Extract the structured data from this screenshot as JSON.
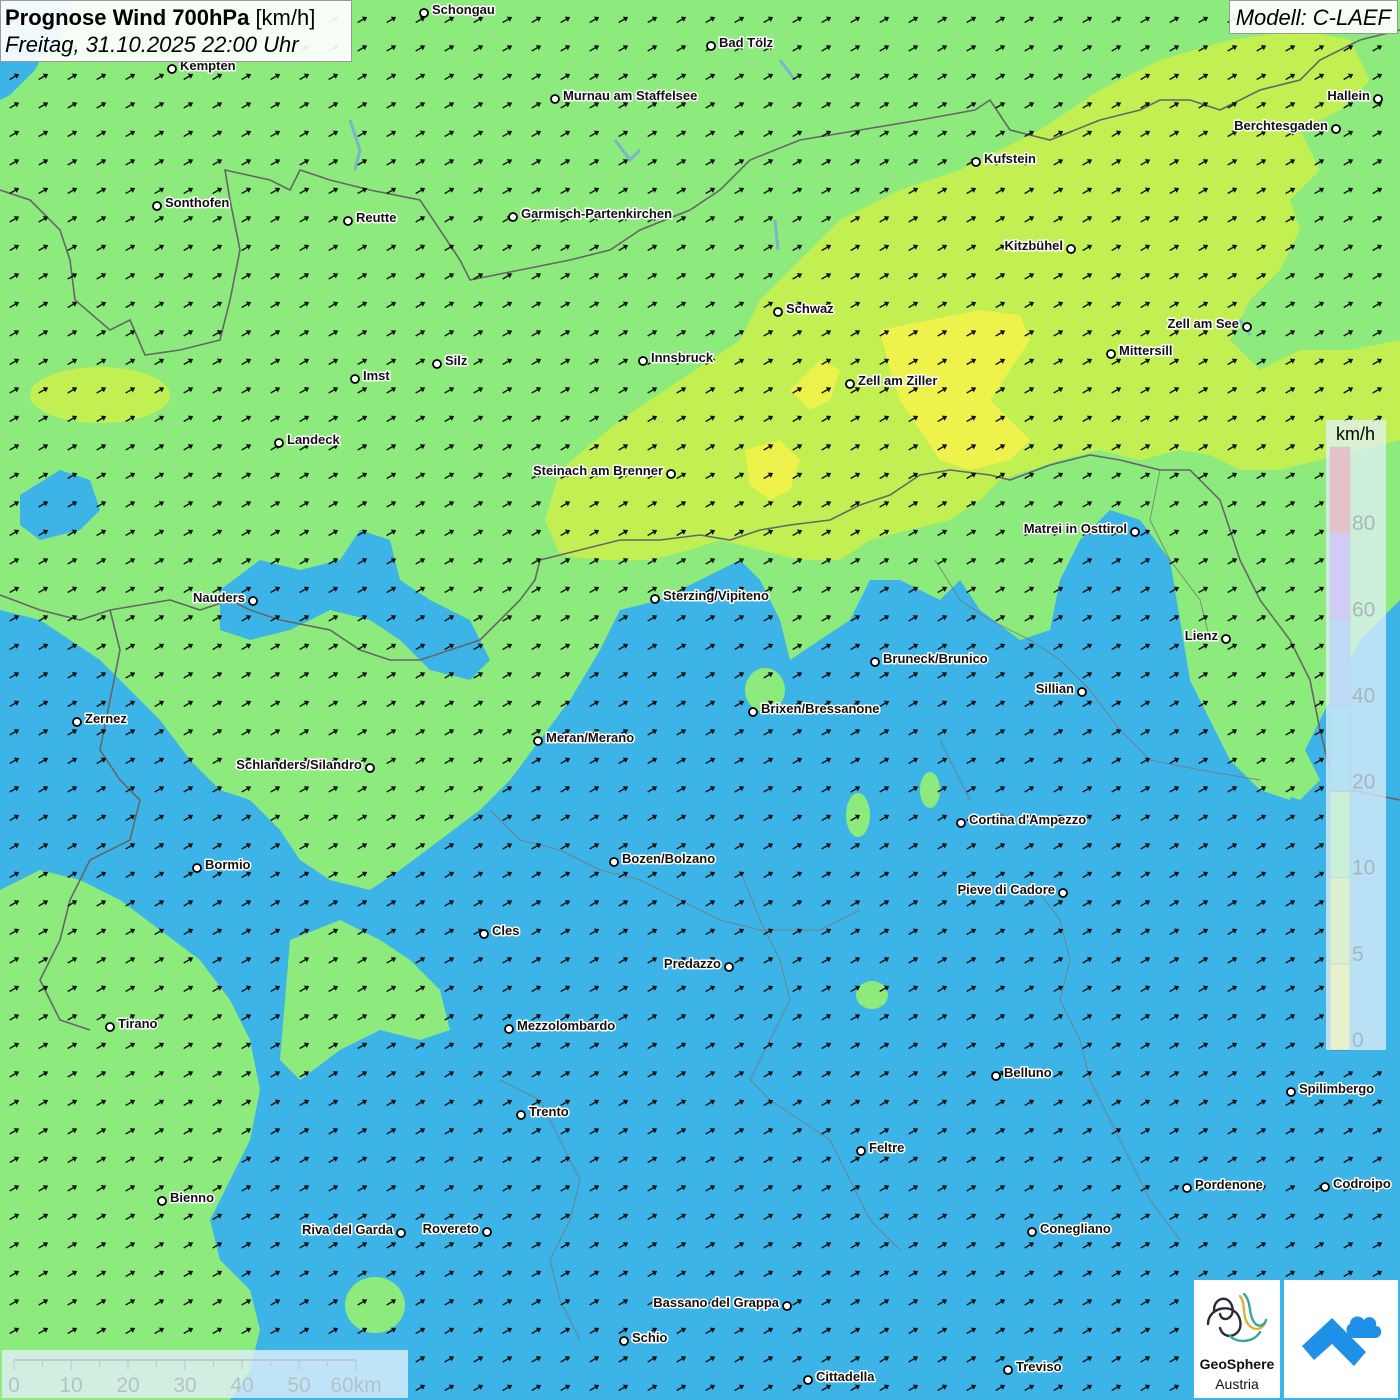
{
  "header": {
    "title_bold": "Prognose Wind 700hPa",
    "title_unit": "[km/h]",
    "datetime": "Freitag, 31.10.2025 22:00 Uhr",
    "model": "Modell: C-LAEF"
  },
  "legend": {
    "unit": "km/h",
    "bins": [
      {
        "color": "#f7f24a",
        "from": 0
      },
      {
        "color": "#c2f052",
        "from": 5
      },
      {
        "color": "#8ceb7c",
        "from": 10
      },
      {
        "color": "#2cbbe8",
        "from": 20
      },
      {
        "color": "#5a96ec",
        "from": 40
      },
      {
        "color": "#9a5ff0",
        "from": 60
      },
      {
        "color": "#ef3838",
        "from": 80
      }
    ],
    "tick_labels": [
      "0",
      "5",
      "10",
      "20",
      "40",
      "60",
      "80"
    ]
  },
  "scalebar": {
    "labels": [
      "0",
      "10",
      "20",
      "30",
      "40",
      "50",
      "60km"
    ]
  },
  "logos": {
    "geosphere_line1": "GeoSphere",
    "geosphere_line2": "Austria"
  },
  "colors": {
    "zone_0_5": "#f7f24a",
    "zone_5_10": "#c2f052",
    "zone_10_20": "#8ceb7c",
    "zone_20_40": "#2cbbe8",
    "arrow": "#111111",
    "border": "#666666"
  },
  "places": [
    {
      "name": "Schongau",
      "side": "right"
    },
    {
      "name": "Bad Tölz",
      "side": "right"
    },
    {
      "name": "Kempten",
      "side": "right"
    },
    {
      "name": "Murnau am Staffelsee",
      "side": "right"
    },
    {
      "name": "Hallein",
      "side": "left"
    },
    {
      "name": "Berchtesgaden",
      "side": "left"
    },
    {
      "name": "Kufstein",
      "side": "right"
    },
    {
      "name": "Sonthofen",
      "side": "right"
    },
    {
      "name": "Reutte",
      "side": "right"
    },
    {
      "name": "Garmisch-Partenkirchen",
      "side": "right"
    },
    {
      "name": "Kitzbühel",
      "side": "left"
    },
    {
      "name": "Schwaz",
      "side": "right"
    },
    {
      "name": "Zell am See",
      "side": "left"
    },
    {
      "name": "Mittersill",
      "side": "right"
    },
    {
      "name": "Innsbruck",
      "side": "right"
    },
    {
      "name": "Silz",
      "side": "right"
    },
    {
      "name": "Imst",
      "side": "right"
    },
    {
      "name": "Zell am Ziller",
      "side": "right"
    },
    {
      "name": "Landeck",
      "side": "right"
    },
    {
      "name": "Steinach am Brenner",
      "side": "left"
    },
    {
      "name": "Matrei in Osttirol",
      "side": "left"
    },
    {
      "name": "Nauders",
      "side": "left"
    },
    {
      "name": "Sterzing/Vipiteno",
      "side": "right"
    },
    {
      "name": "Lienz",
      "side": "left"
    },
    {
      "name": "Bruneck/Brunico",
      "side": "right"
    },
    {
      "name": "Sillian",
      "side": "left"
    },
    {
      "name": "Brixen/Bressanone",
      "side": "right"
    },
    {
      "name": "Zernez",
      "side": "right"
    },
    {
      "name": "Meran/Merano",
      "side": "right"
    },
    {
      "name": "Schlanders/Silandro",
      "side": "left"
    },
    {
      "name": "Cortina d'Ampezzo",
      "side": "right"
    },
    {
      "name": "Bozen/Bolzano",
      "side": "right"
    },
    {
      "name": "Bormio",
      "side": "right"
    },
    {
      "name": "Pieve di Cadore",
      "side": "left"
    },
    {
      "name": "Cles",
      "side": "right"
    },
    {
      "name": "Predazzo",
      "side": "left"
    },
    {
      "name": "Tirano",
      "side": "right"
    },
    {
      "name": "Mezzolombardo",
      "side": "right"
    },
    {
      "name": "Belluno",
      "side": "right"
    },
    {
      "name": "Spilimbergo",
      "side": "right"
    },
    {
      "name": "Trento",
      "side": "right"
    },
    {
      "name": "Feltre",
      "side": "right"
    },
    {
      "name": "Pordenone",
      "side": "right"
    },
    {
      "name": "Codroipo",
      "side": "right"
    },
    {
      "name": "Bienno",
      "side": "right"
    },
    {
      "name": "Riva del Garda",
      "side": "left"
    },
    {
      "name": "Rovereto",
      "side": "left"
    },
    {
      "name": "Conegliano",
      "side": "right"
    },
    {
      "name": "Bassano del Grappa",
      "side": "left"
    },
    {
      "name": "Schio",
      "side": "right"
    },
    {
      "name": "Treviso",
      "side": "right"
    },
    {
      "name": "Cittadella",
      "side": "right"
    }
  ]
}
